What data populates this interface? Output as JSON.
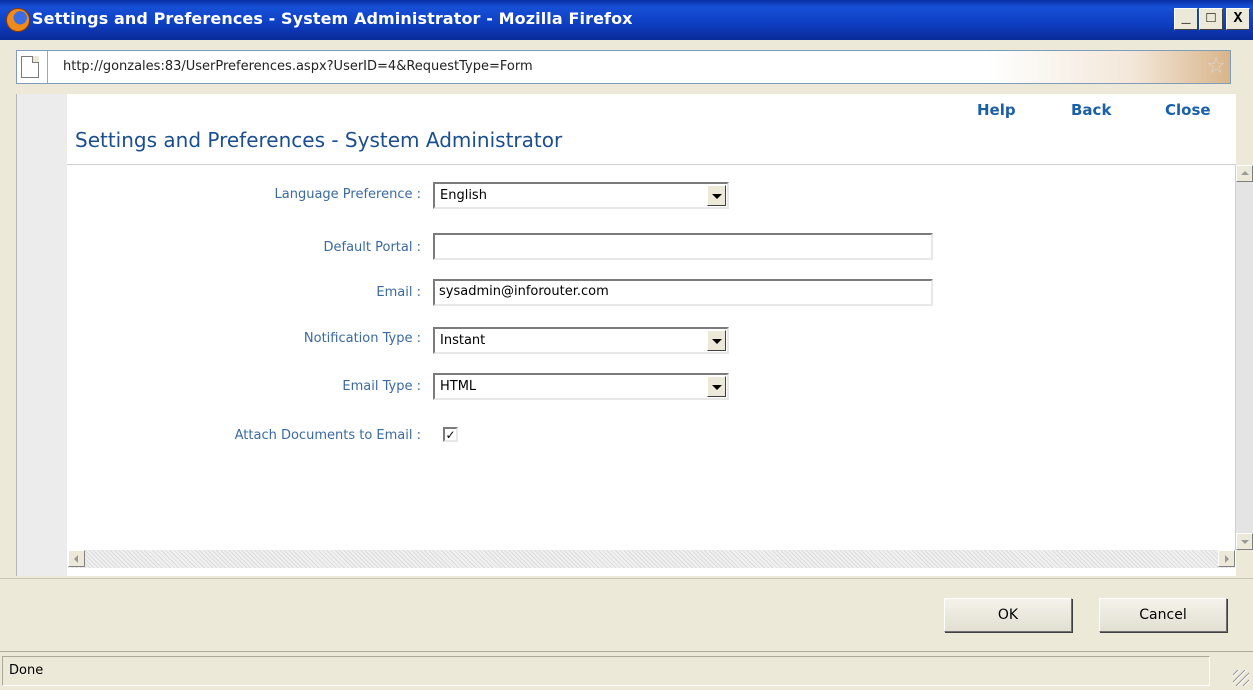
{
  "window": {
    "title": "Settings and Preferences - System Administrator - Mozilla Firefox",
    "minimize_glyph": "_",
    "maximize_glyph": "□",
    "close_glyph": "X"
  },
  "address_bar": {
    "url": "http://gonzales:83/UserPreferences.aspx?UserID=4&RequestType=Form",
    "bookmark_glyph": "☆"
  },
  "header": {
    "links": {
      "help": "Help",
      "back": "Back",
      "close": "Close"
    },
    "title": "Settings and Preferences - System Administrator"
  },
  "form": {
    "language": {
      "label": "Language Preference :",
      "value": "English"
    },
    "default_portal": {
      "label": "Default Portal :",
      "value": ""
    },
    "email": {
      "label": "Email :",
      "value": "sysadmin@inforouter.com"
    },
    "notification_type": {
      "label": "Notification Type :",
      "value": "Instant"
    },
    "email_type": {
      "label": "Email Type :",
      "value": "HTML"
    },
    "attach_documents": {
      "label": "Attach Documents to Email :",
      "checked": true,
      "glyph": "✓"
    }
  },
  "footer": {
    "ok_label": "OK",
    "cancel_label": "Cancel"
  },
  "status": {
    "text": "Done"
  },
  "colors": {
    "title_bar": "#0d3ec2",
    "link": "#1a5fa8",
    "heading": "#1b4e8f",
    "label": "#3b6aa0"
  }
}
